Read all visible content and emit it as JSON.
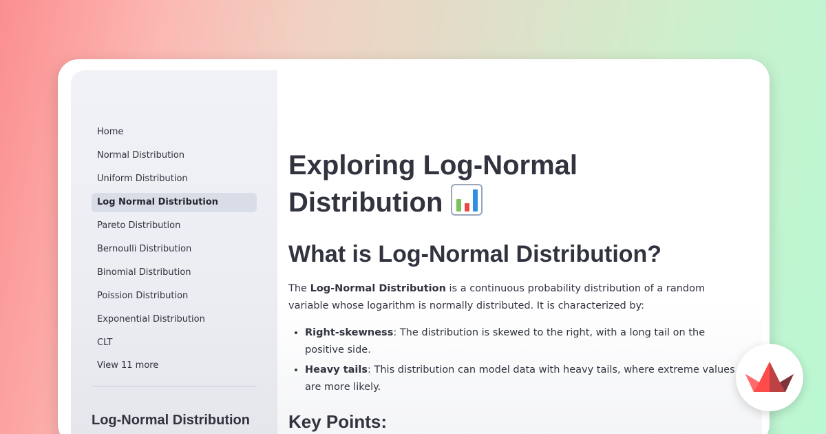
{
  "sidebar": {
    "items": [
      {
        "label": "Home",
        "active": false
      },
      {
        "label": "Normal Distribution",
        "active": false
      },
      {
        "label": "Uniform Distribution",
        "active": false
      },
      {
        "label": "Log Normal Distribution",
        "active": true
      },
      {
        "label": "Pareto Distribution",
        "active": false
      },
      {
        "label": "Bernoulli Distribution",
        "active": false
      },
      {
        "label": "Binomial Distribution",
        "active": false
      },
      {
        "label": "Poission Distribution",
        "active": false
      },
      {
        "label": "Exponential Distribution",
        "active": false
      },
      {
        "label": "CLT",
        "active": false
      }
    ],
    "view_more": "View 11 more",
    "heading": "Log-Normal Distribution"
  },
  "main": {
    "title": "Exploring Log-Normal Distribution",
    "title_icon": "bar-chart-icon",
    "section_heading": "What is Log-Normal Distribution?",
    "intro": {
      "prefix": "The ",
      "bold": "Log-Normal Distribution",
      "suffix": " is a continuous probability distribution of a random variable whose logarithm is normally distributed. It is characterized by:"
    },
    "bullets": [
      {
        "term": "Right-skewness",
        "text": ": The distribution is skewed to the right, with a long tail on the positive side."
      },
      {
        "term": "Heavy tails",
        "text": ": This distribution can model data with heavy tails, where extreme values are more likely."
      }
    ],
    "key_points_heading": "Key Points:"
  },
  "brand": {
    "logo_icon": "streamlit-logo-icon",
    "accent_color": "#ff4b4b"
  }
}
